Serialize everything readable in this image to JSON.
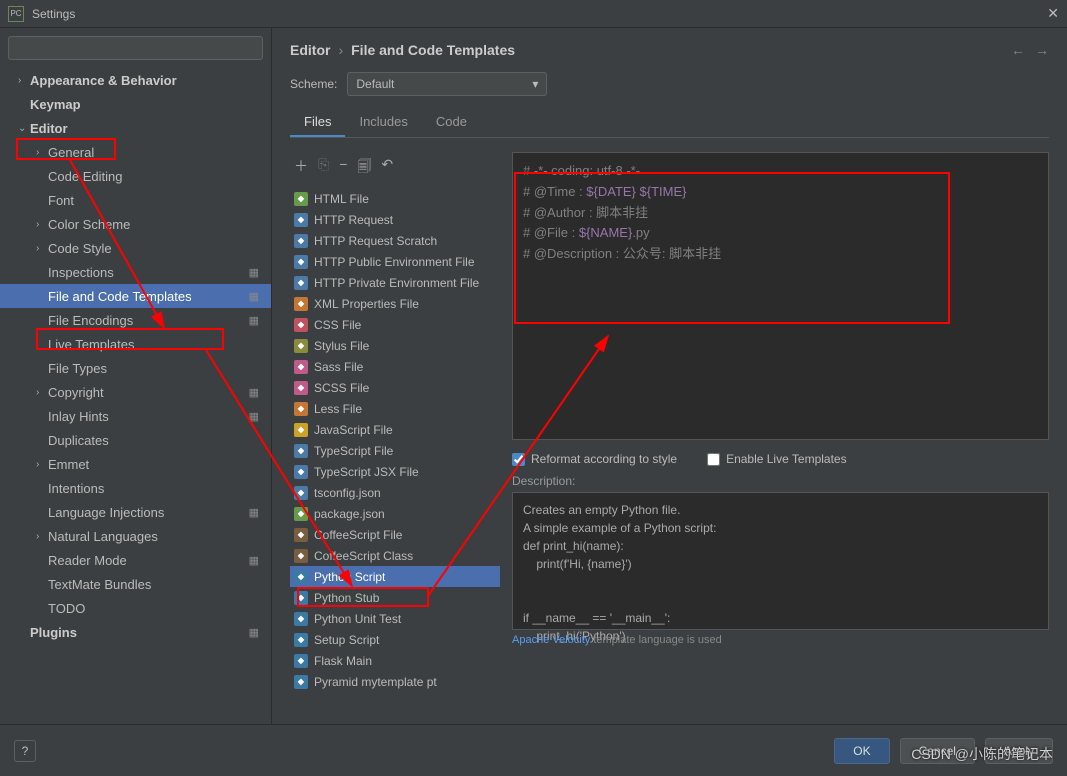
{
  "window": {
    "title": "Settings",
    "logo_text": "PC"
  },
  "sidebar": {
    "search_placeholder": "",
    "items": [
      {
        "label": "Appearance & Behavior",
        "expandable": true,
        "bold": true,
        "lvl": 1
      },
      {
        "label": "Keymap",
        "bold": true,
        "lvl": 1,
        "noChevron": true,
        "redbox": false
      },
      {
        "label": "Editor",
        "expandable": true,
        "expanded": true,
        "bold": true,
        "lvl": 1,
        "redbox": true
      },
      {
        "label": "General",
        "expandable": true,
        "lvl": 2
      },
      {
        "label": "Code Editing",
        "lvl": 2,
        "noChevron": true
      },
      {
        "label": "Font",
        "lvl": 2,
        "noChevron": true
      },
      {
        "label": "Color Scheme",
        "expandable": true,
        "lvl": 2
      },
      {
        "label": "Code Style",
        "expandable": true,
        "lvl": 2
      },
      {
        "label": "Inspections",
        "lvl": 2,
        "gear": true,
        "noChevron": true
      },
      {
        "label": "File and Code Templates",
        "lvl": 2,
        "gear": true,
        "selected": true,
        "redbox": true,
        "noChevron": true
      },
      {
        "label": "File Encodings",
        "lvl": 2,
        "gear": true,
        "noChevron": true
      },
      {
        "label": "Live Templates",
        "lvl": 2,
        "noChevron": true
      },
      {
        "label": "File Types",
        "lvl": 2,
        "noChevron": true
      },
      {
        "label": "Copyright",
        "expandable": true,
        "lvl": 2,
        "gear": true
      },
      {
        "label": "Inlay Hints",
        "lvl": 2,
        "gear": true,
        "noChevron": true
      },
      {
        "label": "Duplicates",
        "lvl": 2,
        "noChevron": true
      },
      {
        "label": "Emmet",
        "expandable": true,
        "lvl": 2
      },
      {
        "label": "Intentions",
        "lvl": 2,
        "noChevron": true
      },
      {
        "label": "Language Injections",
        "lvl": 2,
        "gear": true,
        "noChevron": true
      },
      {
        "label": "Natural Languages",
        "expandable": true,
        "lvl": 2
      },
      {
        "label": "Reader Mode",
        "lvl": 2,
        "gear": true,
        "noChevron": true
      },
      {
        "label": "TextMate Bundles",
        "lvl": 2,
        "noChevron": true
      },
      {
        "label": "TODO",
        "lvl": 2,
        "noChevron": true
      },
      {
        "label": "Plugins",
        "bold": true,
        "lvl": 1,
        "gear": true,
        "noChevron": true
      }
    ]
  },
  "breadcrumb": {
    "part1": "Editor",
    "part2": "File and Code Templates"
  },
  "scheme": {
    "label": "Scheme:",
    "value": "Default"
  },
  "tabs": [
    {
      "label": "Files",
      "active": true
    },
    {
      "label": "Includes"
    },
    {
      "label": "Code"
    }
  ],
  "templates": [
    {
      "label": "HTML File",
      "color": "#659b4b"
    },
    {
      "label": "HTTP Request",
      "color": "#4a7aa5"
    },
    {
      "label": "HTTP Request Scratch",
      "color": "#4a7aa5"
    },
    {
      "label": "HTTP Public Environment File",
      "color": "#4a7aa5"
    },
    {
      "label": "HTTP Private Environment File",
      "color": "#4a7aa5"
    },
    {
      "label": "XML Properties File",
      "color": "#c57633"
    },
    {
      "label": "CSS File",
      "color": "#c0525f"
    },
    {
      "label": "Stylus File",
      "color": "#8b8b3d"
    },
    {
      "label": "Sass File",
      "color": "#c05a8a"
    },
    {
      "label": "SCSS File",
      "color": "#c05a8a"
    },
    {
      "label": "Less File",
      "color": "#c57633"
    },
    {
      "label": "JavaScript File",
      "color": "#c9a227"
    },
    {
      "label": "TypeScript File",
      "color": "#4a7aa5"
    },
    {
      "label": "TypeScript JSX File",
      "color": "#4a7aa5"
    },
    {
      "label": "tsconfig.json",
      "color": "#4a7aa5"
    },
    {
      "label": "package.json",
      "color": "#659b4b"
    },
    {
      "label": "CoffeeScript File",
      "color": "#7a5c3e"
    },
    {
      "label": "CoffeeScript Class",
      "color": "#7a5c3e"
    },
    {
      "label": "Python Script",
      "color": "#3b7aa5",
      "selected": true,
      "redbox": true
    },
    {
      "label": "Python Stub",
      "color": "#3b7aa5"
    },
    {
      "label": "Python Unit Test",
      "color": "#3b7aa5"
    },
    {
      "label": "Setup Script",
      "color": "#3b7aa5"
    },
    {
      "label": "Flask Main",
      "color": "#3b7aa5"
    },
    {
      "label": "Pyramid mytemplate pt",
      "color": "#3b7aa5"
    }
  ],
  "template_code": {
    "line1": "# -*- coding: utf-8 -*-",
    "line2_pre": "# @Time    : ",
    "line2_var1": "${DATE}",
    "line2_mid": " ",
    "line2_var2": "${TIME}",
    "line3": "# @Author  : 脚本非挂",
    "line4_pre": "# @File    : ",
    "line4_var": "${NAME}",
    "line4_post": ".py",
    "line5": "# @Description : 公众号: 脚本非挂"
  },
  "options": {
    "reformat_label": "Reformat according to style",
    "reformat_checked": true,
    "live_label": "Enable Live Templates",
    "live_checked": false
  },
  "description": {
    "label": "Description:",
    "text": "Creates an empty Python file.\nA simple example of a Python script:\ndef print_hi(name):\n    print(f'Hi, {name}')\n\n\nif __name__ == '__main__':\n    print_hi('Python')"
  },
  "footer_note": {
    "link": "Apache Velocity",
    "rest": " template language is used"
  },
  "buttons": {
    "ok": "OK",
    "cancel": "Cancel",
    "apply": "Apply"
  },
  "watermark": "CSDN @小陈的笔记本"
}
